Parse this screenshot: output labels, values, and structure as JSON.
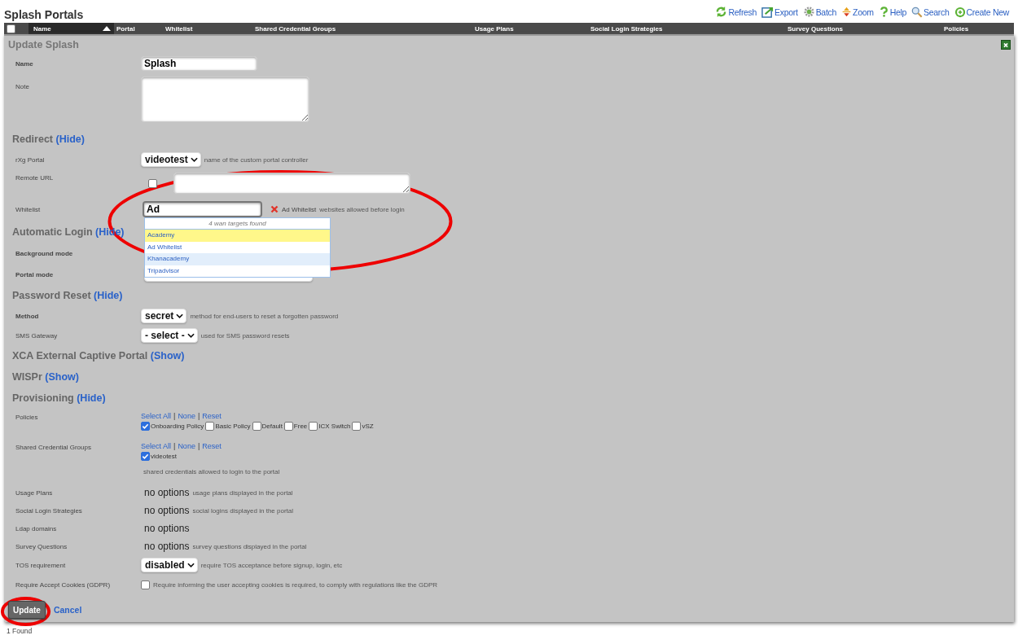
{
  "page_title": "Splash Portals",
  "toolbar": [
    {
      "label": "Refresh"
    },
    {
      "label": "Export"
    },
    {
      "label": "Batch"
    },
    {
      "label": "Zoom"
    },
    {
      "label": "Help"
    },
    {
      "label": "Search"
    },
    {
      "label": "Create New"
    }
  ],
  "table": {
    "select_all_checked": false,
    "columns": [
      {
        "label": "Name",
        "sorted": true
      },
      {
        "label": "Portal",
        "sorted": false
      },
      {
        "label": "Whitelist",
        "sorted": false
      },
      {
        "label": "Shared Credential Groups",
        "sorted": false
      },
      {
        "label": "Usage Plans",
        "sorted": false
      },
      {
        "label": "Social Login Strategies",
        "sorted": false
      },
      {
        "label": "Survey Questions",
        "sorted": false
      },
      {
        "label": "Policies",
        "sorted": false
      }
    ]
  },
  "form": {
    "title": "Update Splash",
    "rows": [
      {
        "kind": "text",
        "label": "Name",
        "bold_label": true,
        "value": "Splash"
      },
      {
        "kind": "textarea",
        "label": "Note",
        "bold_label": false
      },
      {
        "kind": "heading",
        "title": "Redirect",
        "toggle": "(Hide)"
      },
      {
        "kind": "select",
        "label": "rXg Portal",
        "bold_label": false,
        "value": "videotest",
        "hint": "name of the custom portal controller"
      },
      {
        "kind": "url",
        "label": "Remote URL",
        "bold_label": false,
        "checked": false
      },
      {
        "kind": "autocomplete",
        "label": "Whitelist",
        "bold_label": false,
        "value": "Ad",
        "tag": "Ad Whitelist",
        "hint": "websites allowed before login",
        "suggestions": {
          "header": "4 wan targets found",
          "items": [
            {
              "label": "Academy",
              "selected": true,
              "hovered": false
            },
            {
              "label": "Ad Whitelist",
              "selected": false,
              "hovered": false
            },
            {
              "label": "Khanacademy",
              "selected": false,
              "hovered": true
            },
            {
              "label": "Tripadvisor",
              "selected": false,
              "hovered": false
            }
          ]
        }
      },
      {
        "kind": "heading",
        "title": "Automatic Login",
        "toggle": "(Hide)"
      },
      {
        "kind": "covered",
        "label": "Background mode",
        "bold_label": true
      },
      {
        "kind": "covered_select",
        "label": "Portal mode",
        "bold_label": true
      },
      {
        "kind": "heading",
        "title": "Password Reset",
        "toggle": "(Hide)"
      },
      {
        "kind": "select",
        "label": "Method",
        "bold_label": true,
        "value": "secret",
        "hint": "method for end-users to reset a forgotten password"
      },
      {
        "kind": "select",
        "label": "SMS Gateway",
        "bold_label": false,
        "value": "- select -",
        "hint": "used for SMS password resets"
      },
      {
        "kind": "heading",
        "title": "XCA External Captive Portal",
        "toggle": "(Show)"
      },
      {
        "kind": "heading",
        "title": "WISPr",
        "toggle": "(Show)"
      },
      {
        "kind": "heading",
        "title": "Provisioning",
        "toggle": "(Hide)"
      },
      {
        "kind": "checklist",
        "label": "Policies",
        "bold_label": false,
        "links": [
          "Select All",
          "None",
          "Reset"
        ],
        "separator": "|",
        "options": [
          {
            "label": "Onboarding Policy",
            "checked": true
          },
          {
            "label": "Basic Policy",
            "checked": false
          },
          {
            "label": "Default",
            "checked": false
          },
          {
            "label": "Free",
            "checked": false
          },
          {
            "label": "ICX Switch",
            "checked": false
          },
          {
            "label": "vSZ",
            "checked": false
          }
        ]
      },
      {
        "kind": "checklist",
        "label": "Shared Credential Groups",
        "bold_label": false,
        "links": [
          "Select All",
          "None",
          "Reset"
        ],
        "separator": "|",
        "options": [
          {
            "label": "videotest",
            "checked": true
          }
        ],
        "hint": "shared credentials allowed to login to the portal"
      },
      {
        "kind": "options",
        "label": "Usage Plans",
        "bold_label": false,
        "value": "no options",
        "hint": "usage plans displayed in the portal"
      },
      {
        "kind": "options",
        "label": "Social Login Strategies",
        "bold_label": false,
        "value": "no options",
        "hint": "social logins displayed in the portal"
      },
      {
        "kind": "options",
        "label": "Ldap domains",
        "bold_label": false,
        "value": "no options"
      },
      {
        "kind": "options",
        "label": "Survey Questions",
        "bold_label": false,
        "value": "no options",
        "hint": "survey questions displayed in the portal"
      },
      {
        "kind": "select",
        "label": "TOS requirement",
        "bold_label": false,
        "value": "disabled",
        "hint": "require TOS acceptance before signup, login, etc"
      },
      {
        "kind": "checkbox",
        "label": "Require Accept Cookies (GDPR)",
        "bold_label": false,
        "checked": false,
        "hint": "Require informing the user accepting cookies is required, to comply with regulations like the GDPR"
      }
    ],
    "submit": "Update",
    "cancel": "Cancel"
  },
  "found": "1 Found",
  "annotations": [
    {
      "kind": "ellipse"
    },
    {
      "kind": "ellipse"
    }
  ]
}
